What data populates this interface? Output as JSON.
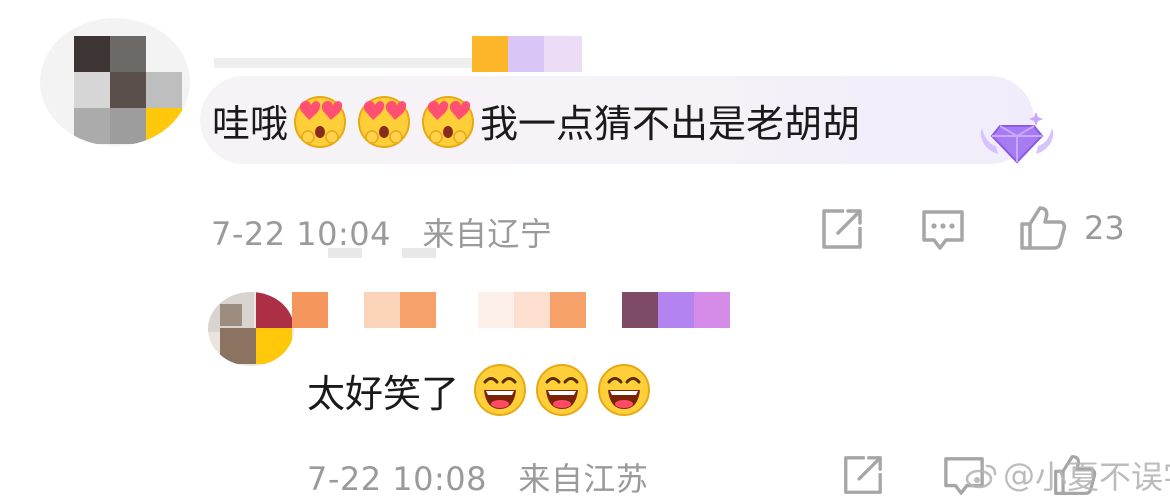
{
  "comments": [
    {
      "text": "哇哦",
      "text_after": "我一点猜不出是老胡胡",
      "emoji_name": "heart-eyes-emoji",
      "emoji_count": 3,
      "time": "7-22 10:04",
      "location": "来自辽宁",
      "like_count": "23",
      "badge": "diamond-badge"
    },
    {
      "text": "太好笑了",
      "emoji_name": "laughing-emoji",
      "emoji_count": 3,
      "time": "7-22 10:08",
      "location": "来自江苏"
    }
  ],
  "watermark": {
    "prefix": "@",
    "name": "小夏不误字"
  },
  "colors": {
    "bubble": "#f4f1f8",
    "meta_text": "#9a9a9a",
    "icon_stroke": "#a6a6a6",
    "badge_purple": "#9b6cf0"
  }
}
